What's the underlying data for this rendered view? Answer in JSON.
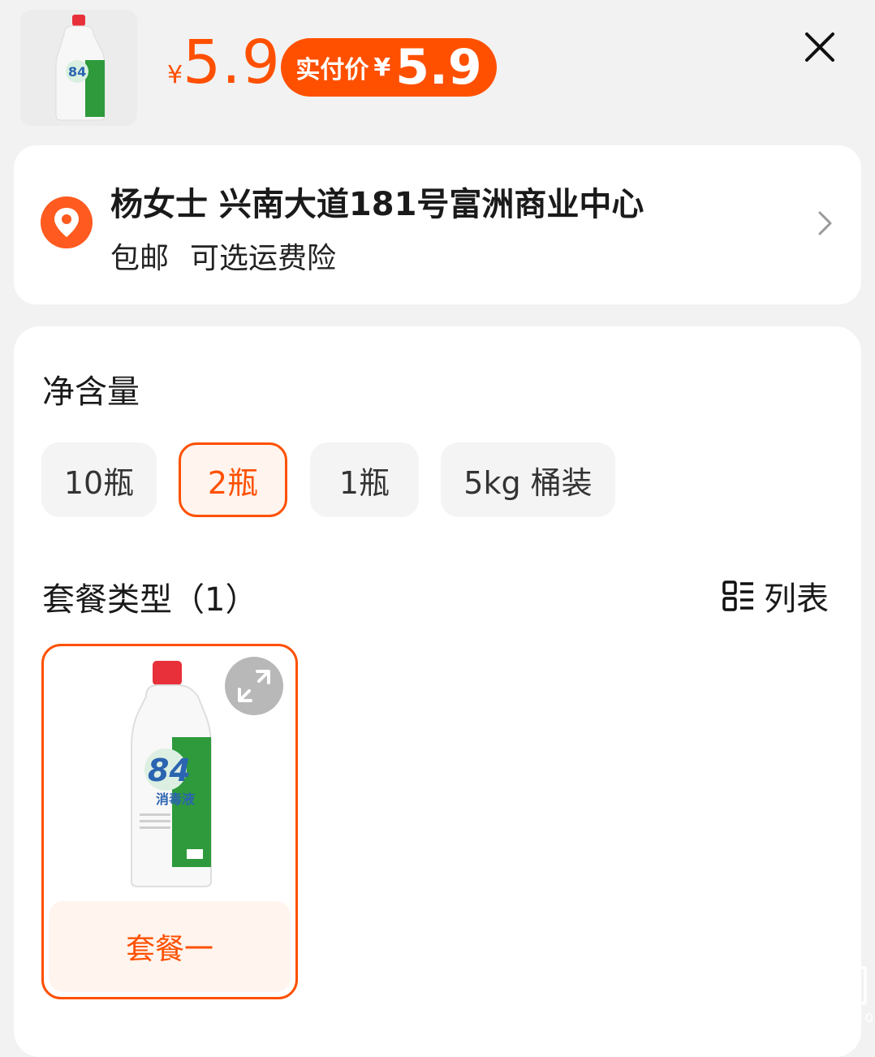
{
  "header": {
    "currency": "¥",
    "price": "5.9",
    "pill_label": "实付价",
    "pill_currency": "¥",
    "pill_price": "5.9"
  },
  "address": {
    "name_line": "杨女士 兴南大道181号富洲商业中心",
    "shipping": "包邮",
    "insurance": "可选运费险"
  },
  "spec": {
    "net_content_title": "净含量",
    "options": [
      {
        "label": "10瓶",
        "selected": false
      },
      {
        "label": "2瓶",
        "selected": true
      },
      {
        "label": "1瓶",
        "selected": false
      },
      {
        "label": "5kg 桶装",
        "selected": false
      }
    ],
    "package_title": "套餐类型（1）",
    "list_toggle_label": "列表",
    "packages": [
      {
        "label": "套餐一",
        "selected": true
      }
    ]
  },
  "product_image": {
    "bottle_number": "84",
    "bottle_text": "消毒液"
  },
  "watermark": {
    "chars": "值值值",
    "domain": "zhizhizhi.com"
  },
  "colors": {
    "accent": "#ff5000",
    "selected_bg": "#fff4ee",
    "option_bg": "#f4f4f4",
    "page_bg": "#f2f2f2"
  },
  "icons": {
    "close": "close-icon",
    "pin": "location-pin-icon",
    "chevron": "chevron-right-icon",
    "list": "list-view-icon",
    "expand": "expand-icon"
  }
}
